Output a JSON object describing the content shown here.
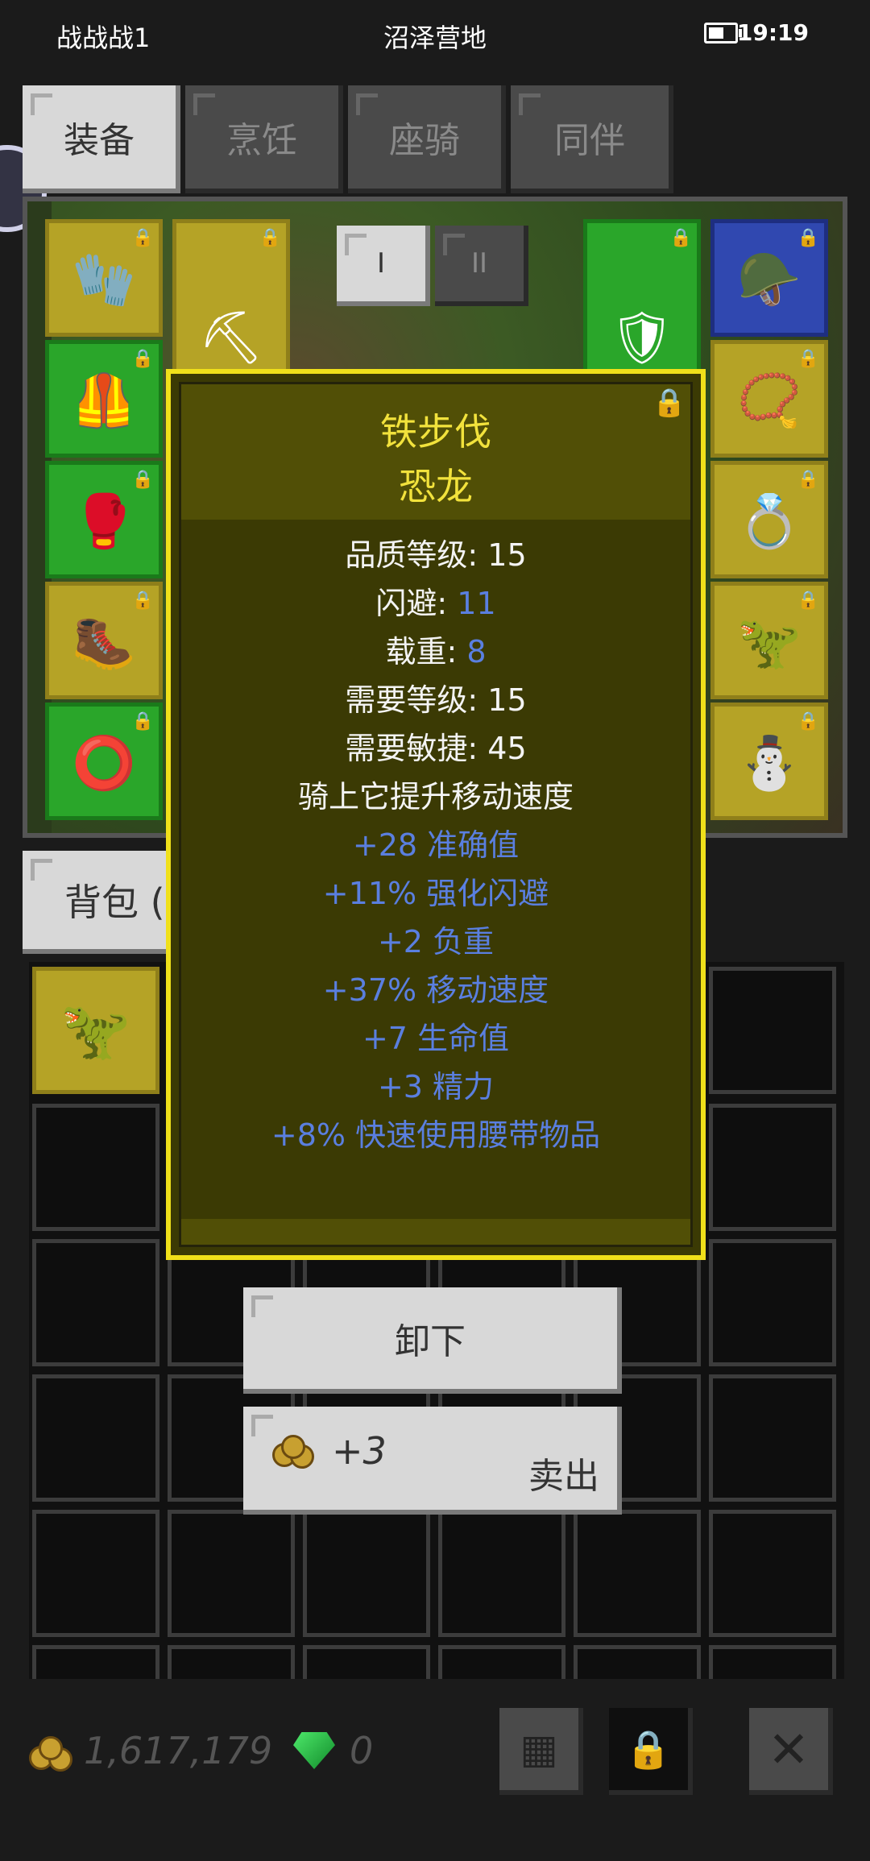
{
  "status_bar": {
    "player": "战战战1",
    "location": "沼泽营地",
    "time": "19:19"
  },
  "tabs": [
    {
      "label": "装备"
    },
    {
      "label": "烹饪"
    },
    {
      "label": "座骑"
    },
    {
      "label": "同伴"
    }
  ],
  "loadout": {
    "one": "I",
    "two": "II"
  },
  "bag_tab": {
    "label": "背包 ("
  },
  "tooltip": {
    "title": "铁步伐",
    "subtitle": "恐龙",
    "stats": [
      {
        "label": "品质等级: ",
        "value": "15",
        "color": "white"
      },
      {
        "label": "闪避: ",
        "value": "11",
        "color": "blue"
      },
      {
        "label": "载重: ",
        "value": "8",
        "color": "blue"
      },
      {
        "label": "需要等级: ",
        "value": "15",
        "color": "white"
      },
      {
        "label": "需要敏捷: ",
        "value": "45",
        "color": "white"
      }
    ],
    "description": "骑上它提升移动速度",
    "bonuses": [
      "+28 准确值",
      "+11% 强化闪避",
      "+2 负重",
      "+37% 移动速度",
      "+7 生命值",
      "+3 精力",
      "+8% 快速使用腰带物品"
    ]
  },
  "actions": {
    "unequip": "卸下",
    "sell_price": "+3",
    "sell": "卖出"
  },
  "bottom": {
    "gold": "1,617,179",
    "gems": "0"
  },
  "colors": {
    "tooltip_border": "#f0e01a",
    "tooltip_title": "#f2e23c",
    "bonus_text": "#5a7fe0"
  }
}
